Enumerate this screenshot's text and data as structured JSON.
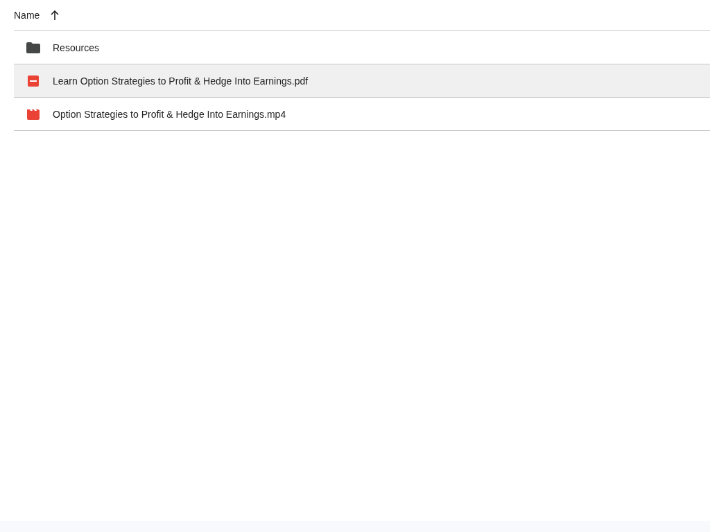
{
  "header": {
    "column": "Name",
    "ascending": true
  },
  "rows": [
    {
      "kind": "folder",
      "name": "Resources",
      "selected": false
    },
    {
      "kind": "pdf",
      "name": "Learn Option Strategies to Profit & Hedge Into Earnings.pdf",
      "selected": true
    },
    {
      "kind": "video",
      "name": "Option Strategies to Profit & Hedge Into Earnings.mp4",
      "selected": false
    }
  ]
}
